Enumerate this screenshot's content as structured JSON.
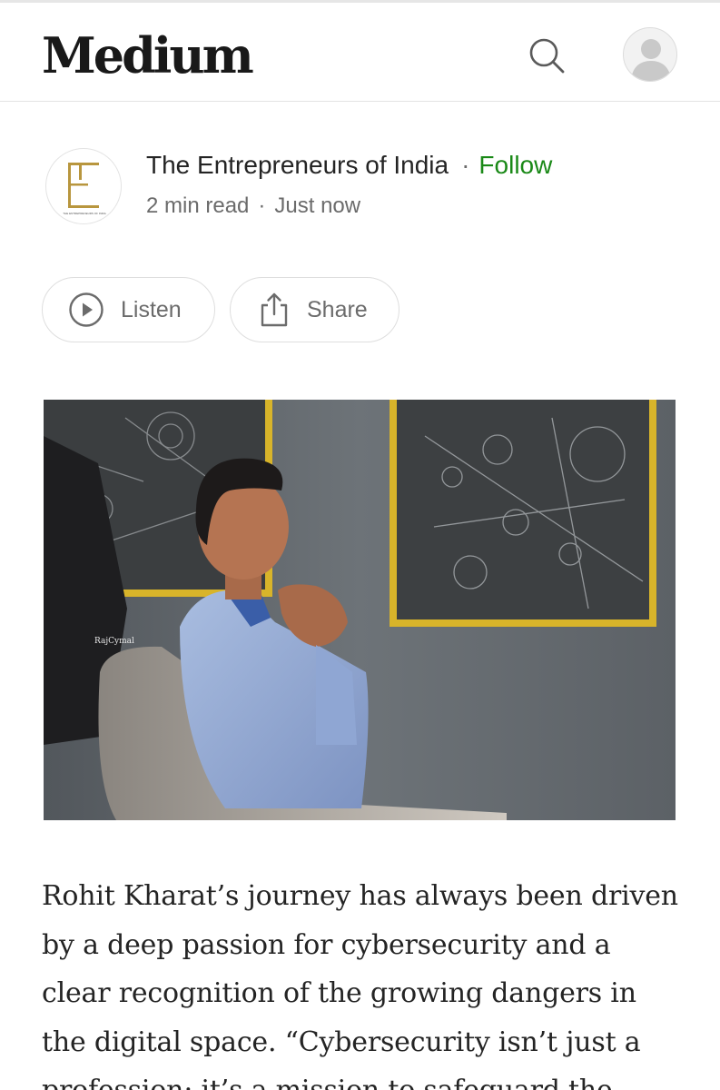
{
  "header": {
    "logo": "Medium",
    "icons": {
      "search": "search-icon",
      "avatar": "user-avatar-icon"
    }
  },
  "publication": {
    "name": "The Entrepreneurs of India",
    "follow_label": "Follow",
    "logo_caption": "THE ENTREPRENEURS OF INDIA",
    "logo_color": "#b8963e"
  },
  "meta": {
    "read_time": "2 min read",
    "published": "Just now"
  },
  "actions": {
    "listen_label": "Listen",
    "share_label": "Share"
  },
  "hero": {
    "watermark": "RajCymal"
  },
  "article": {
    "paragraph": "Rohit Kharat’s journey has always been driven by a deep passion for cybersecurity and a clear recognition of the growing dangers in the digital space. “Cybersecurity isn’t just a profession; it’s a mission to safeguard the"
  },
  "colors": {
    "follow": "#1a8917",
    "text": "#242424",
    "muted": "#6b6b6b",
    "frame_yellow": "#d8b42a"
  }
}
